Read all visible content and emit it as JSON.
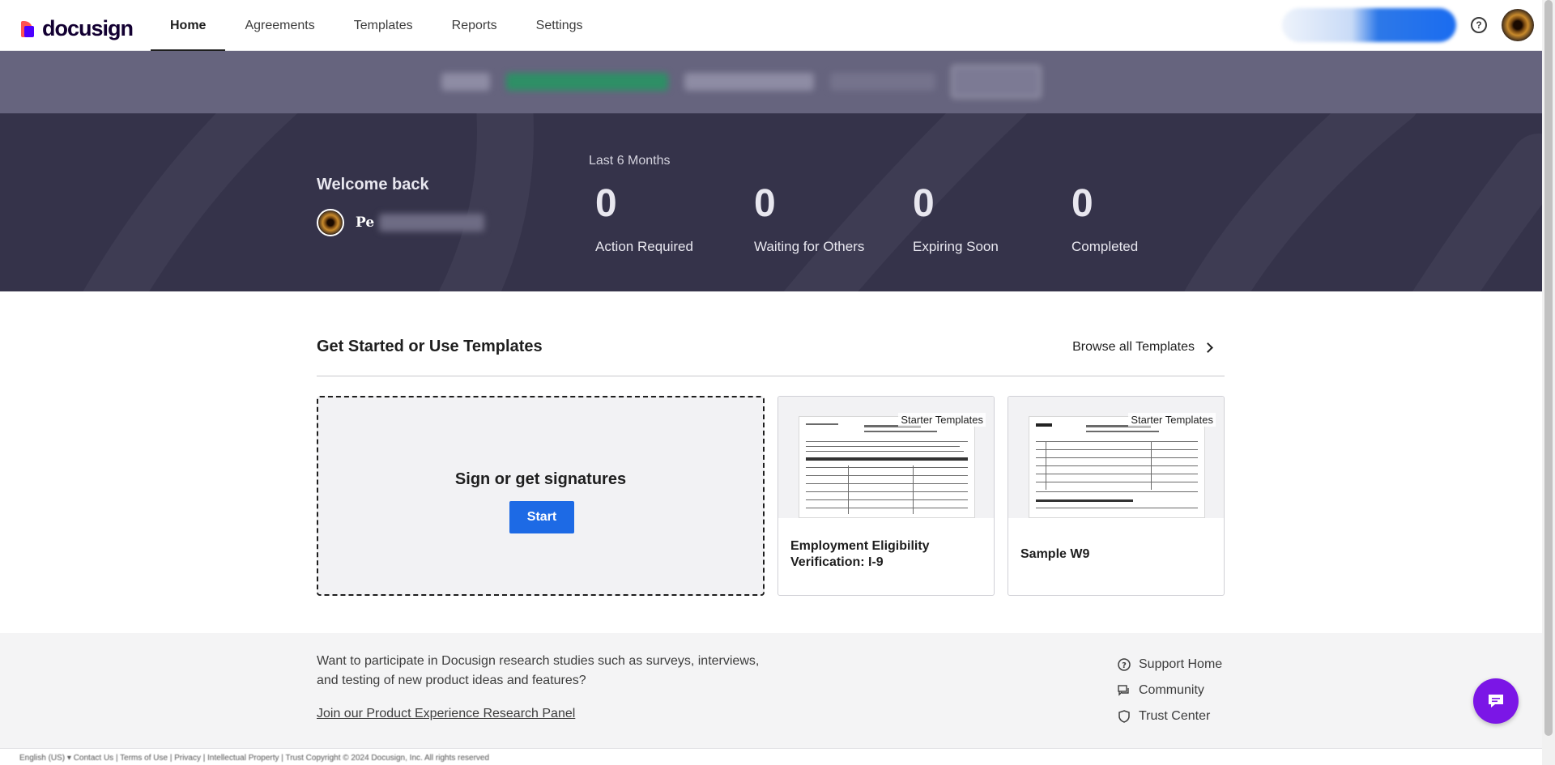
{
  "brand": {
    "name": "docusign",
    "primary_color": "#4c00ff",
    "accent_color": "#ff5252"
  },
  "nav": {
    "tabs": [
      {
        "label": "Home",
        "active": true
      },
      {
        "label": "Agreements",
        "active": false
      },
      {
        "label": "Templates",
        "active": false
      },
      {
        "label": "Reports",
        "active": false
      },
      {
        "label": "Settings",
        "active": false
      }
    ],
    "help_icon": "help-circle-icon"
  },
  "hero": {
    "welcome": "Welcome back",
    "user_name": "Pe",
    "period": "Last 6 Months",
    "stats": [
      {
        "value": "0",
        "label": "Action Required"
      },
      {
        "value": "0",
        "label": "Waiting for Others"
      },
      {
        "value": "0",
        "label": "Expiring Soon"
      },
      {
        "value": "0",
        "label": "Completed"
      }
    ]
  },
  "templates": {
    "title": "Get Started or Use Templates",
    "browse_label": "Browse all Templates",
    "start_card": {
      "title": "Sign or get signatures",
      "button": "Start"
    },
    "cards": [
      {
        "tag": "Starter Templates",
        "name": "Employment Eligibility Verification: I-9"
      },
      {
        "tag": "Starter Templates",
        "name": "Sample W9"
      }
    ]
  },
  "footer": {
    "research_text": "Want to participate in Docusign research studies such as surveys, interviews, and testing of new product ideas and features?",
    "research_link": "Join our Product Experience Research Panel",
    "links": [
      {
        "label": "Support Home",
        "icon": "help-circle-icon"
      },
      {
        "label": "Community",
        "icon": "chat-bubbles-icon"
      },
      {
        "label": "Trust Center",
        "icon": "shield-icon"
      }
    ],
    "legal": "English (US) ▾   Contact Us  |  Terms of Use  |  Privacy  |  Intellectual Property  |  Trust      Copyright © 2024 Docusign, Inc. All rights reserved"
  },
  "chat": {
    "icon": "chat-icon",
    "color": "#7b16e6"
  }
}
